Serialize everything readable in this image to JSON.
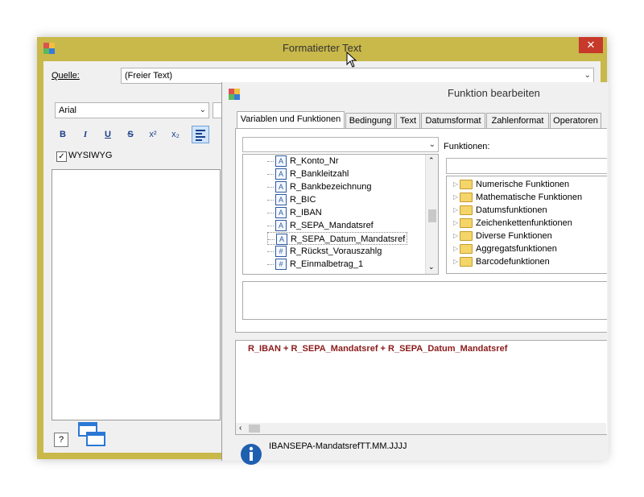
{
  "outer_window": {
    "title": "Formatierter Text",
    "close": "✕",
    "source_label": "Quelle:",
    "source_value": "(Freier Text)",
    "font_value": "Arial",
    "format_buttons": [
      "B",
      "I",
      "U",
      "S",
      "x²",
      "x₂"
    ],
    "wysiwyg_label": "WYSIWYG",
    "wysiwyg_checked": true,
    "help_icon": "?"
  },
  "inner_window": {
    "title": "Funktion bearbeiten",
    "tabs": [
      "Variablen und Funktionen",
      "Bedingung",
      "Text",
      "Datumsformat",
      "Zahlenformat",
      "Operatoren"
    ],
    "active_tab": 0,
    "functions_label": "Funktionen:",
    "variables": [
      {
        "icon": "A",
        "name": "R_Konto_Nr"
      },
      {
        "icon": "A",
        "name": "R_Bankleitzahl"
      },
      {
        "icon": "A",
        "name": "R_Bankbezeichnung"
      },
      {
        "icon": "A",
        "name": "R_BIC"
      },
      {
        "icon": "A",
        "name": "R_IBAN"
      },
      {
        "icon": "A",
        "name": "R_SEPA_Mandatsref"
      },
      {
        "icon": "A",
        "name": "R_SEPA_Datum_Mandatsref"
      },
      {
        "icon": "#",
        "name": "R_Rückst_Vorauszahlg"
      },
      {
        "icon": "#",
        "name": "R_Einmalbetrag_1"
      }
    ],
    "function_groups": [
      "Numerische Funktionen",
      "Mathematische Funktionen",
      "Datumsfunktionen",
      "Zeichenkettenfunktionen",
      "Diverse Funktionen",
      "Aggregatsfunktionen",
      "Barcodefunktionen"
    ],
    "expression": "R_IBAN + R_SEPA_Mandatsref + R_SEPA_Datum_Mandatsref",
    "preview": "IBANSEPA-MandatsrefTT.MM.JJJJ"
  }
}
